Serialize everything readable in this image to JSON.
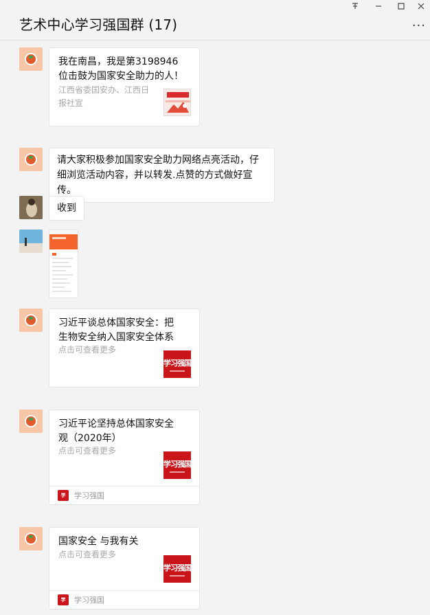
{
  "window": {
    "title": "艺术中心学习强国群 (17)",
    "pin_icon": "pin-icon",
    "minimize_icon": "minimize-icon",
    "maximize_icon": "maximize-icon",
    "close_icon": "close-icon",
    "more_label": "···"
  },
  "messages": [
    {
      "type": "link_card",
      "title": "我在南昌，我是第3198946位击鼓为国家安全助力的人！",
      "desc": "江西省委国安办、江西日报社宣"
    },
    {
      "type": "text",
      "text": "请大家积极参加国家安全助力网络点亮活动，仔细浏览活动内容，并以转发.点赞的方式做好宣传。"
    },
    {
      "type": "text",
      "text": "收到"
    },
    {
      "type": "image"
    },
    {
      "type": "link_card",
      "title": "习近平谈总体国家安全：把生物安全纳入国家安全体系",
      "desc": "点击可查看更多",
      "thumb_text": "学习强国"
    },
    {
      "type": "link_card",
      "title": "习近平论坚持总体国家安全观（2020年）",
      "desc": "点击可查看更多",
      "thumb_text": "学习强国",
      "source": "学习强国"
    },
    {
      "type": "link_card",
      "title": "国家安全 与我有关",
      "desc": "点击可查看更多",
      "thumb_text": "学习强国",
      "source": "学习强国"
    }
  ],
  "colors": {
    "background": "#f3f3f3",
    "card": "#ffffff",
    "brand_red": "#c9141a",
    "muted_text": "#a8a8a8"
  }
}
